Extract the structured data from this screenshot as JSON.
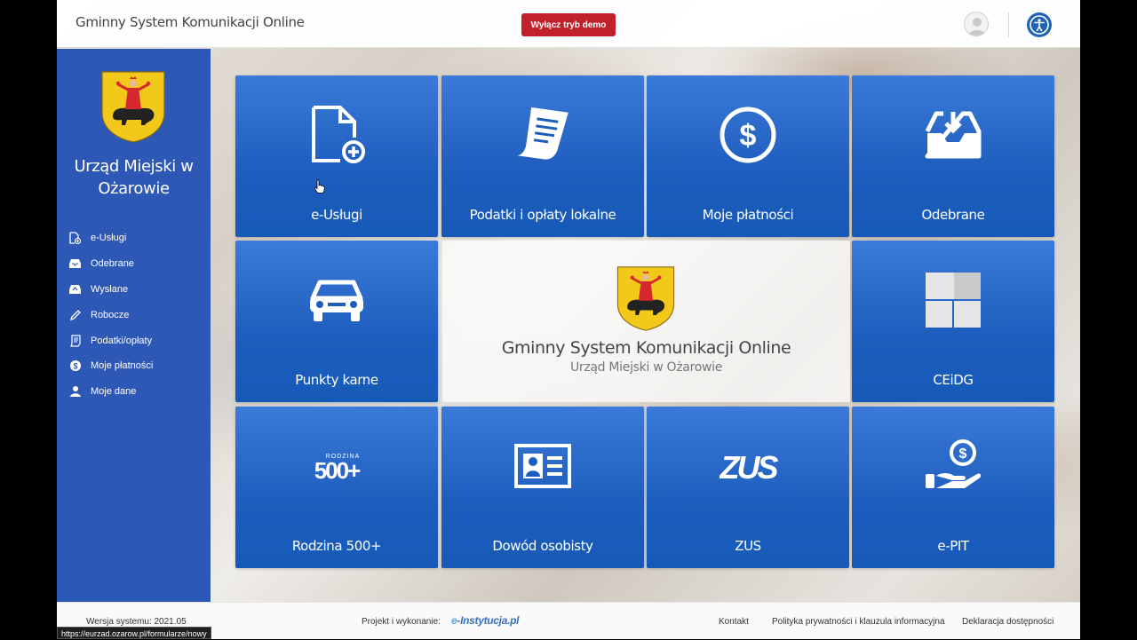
{
  "header": {
    "app_title": "Gminny System Komunikacji Online",
    "demo_button": "Wyłącz tryb demo",
    "avatar_icon": "user-avatar-icon",
    "accessibility_icon": "accessibility-icon"
  },
  "sidebar": {
    "office_name": "Urząd Miejski w Ożarowie",
    "items": [
      {
        "label": "e-Usługi",
        "icon": "document-plus-icon"
      },
      {
        "label": "Odebrane",
        "icon": "inbox-icon"
      },
      {
        "label": "Wysłane",
        "icon": "outbox-icon"
      },
      {
        "label": "Robocze",
        "icon": "pencil-icon"
      },
      {
        "label": "Podatki/opłaty",
        "icon": "receipt-icon"
      },
      {
        "label": "Moje płatności",
        "icon": "dollar-icon"
      },
      {
        "label": "Moje dane",
        "icon": "person-icon"
      }
    ]
  },
  "tiles": [
    {
      "label": "e-Usługi",
      "icon": "document-plus-icon"
    },
    {
      "label": "Podatki i opłaty lokalne",
      "icon": "receipt-icon"
    },
    {
      "label": "Moje płatności",
      "icon": "dollar-circle-icon"
    },
    {
      "label": "Odebrane",
      "icon": "inbox-download-icon"
    },
    {
      "label": "Punkty karne",
      "icon": "car-icon"
    },
    {
      "label": "CEiDG",
      "icon": "ceidg-logo-icon"
    },
    {
      "label": "Rodzina 500+",
      "icon": "rodzina-500-logo-icon"
    },
    {
      "label": "Dowód osobisty",
      "icon": "id-card-icon"
    },
    {
      "label": "ZUS",
      "icon": "zus-logo-icon"
    },
    {
      "label": "e-PIT",
      "icon": "hand-dollar-icon"
    }
  ],
  "center": {
    "title": "Gminny System Komunikacji Online",
    "subtitle": "Urząd Miejski w Ożarowie"
  },
  "logos": {
    "rodzina_small": "RODZINA",
    "rodzina_big": "500+",
    "zus": "ZUS"
  },
  "footer": {
    "version": "Wersja systemu: 2021.05",
    "project_label": "Projekt i wykonanie:",
    "brand_prefix": "e",
    "brand_rest": "-Instytucja.pl",
    "contact": "Kontakt",
    "privacy": "Polityka prywatności i klauzula informacyjna",
    "accessibility": "Deklaracja dostępności"
  },
  "status_url": "https://eurzad.ozarow.pl/formularze/nowy",
  "colors": {
    "sidebar": "#2d58b6",
    "tile": "#1e5dbd",
    "demo_button": "#c0212a"
  }
}
